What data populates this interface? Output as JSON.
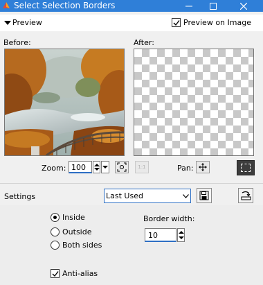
{
  "window": {
    "title": "Select Selection Borders",
    "controls": [
      "minimize",
      "maximize",
      "close"
    ]
  },
  "preview": {
    "section_label": "Preview",
    "preview_on_image_label": "Preview on Image",
    "preview_on_image_checked": true,
    "before_label": "Before:",
    "after_label": "After:",
    "zoom_label": "Zoom:",
    "zoom_value": "100",
    "pan_label": "Pan:"
  },
  "settings": {
    "label": "Settings",
    "preset_value": "Last Used",
    "position_options": [
      {
        "label": "Inside",
        "selected": true
      },
      {
        "label": "Outside",
        "selected": false
      },
      {
        "label": "Both sides",
        "selected": false
      }
    ],
    "border_width_label": "Border width:",
    "border_width_value": "10",
    "anti_alias_label": "Anti-alias",
    "anti_alias_checked": true
  },
  "colors": {
    "titlebar": "#2f7fd8",
    "focus_blue": "#2d6fc4",
    "checker": "#c8c8c8"
  },
  "icons": [
    "app-icon",
    "minimize-icon",
    "maximize-icon",
    "close-icon",
    "collapse-triangle-icon",
    "checkmark-icon",
    "spin-up-icon",
    "spin-down-icon",
    "zoom-fit-icon",
    "zoom-actual-size-icon",
    "pan-move-icon",
    "selection-marquee-icon",
    "dropdown-arrow-icon",
    "save-preset-icon",
    "reset-defaults-icon"
  ]
}
